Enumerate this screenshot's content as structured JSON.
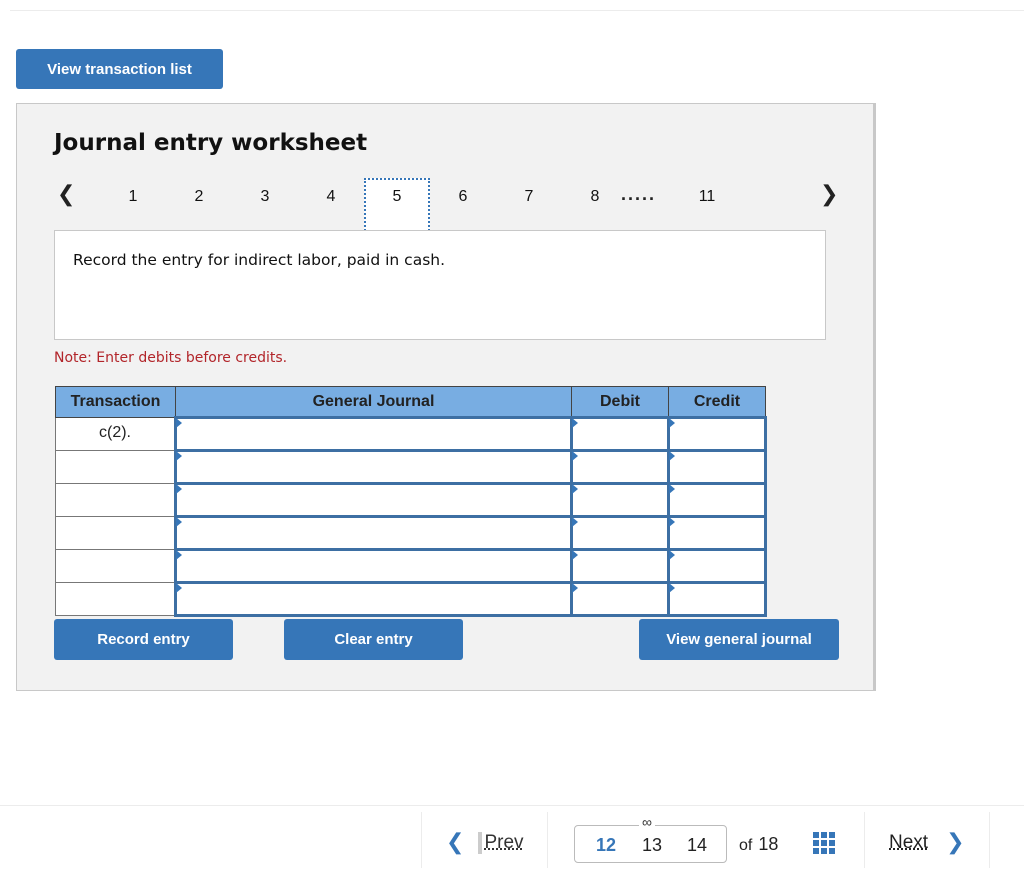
{
  "header": {
    "view_transactions_label": "View transaction list"
  },
  "worksheet": {
    "title": "Journal entry worksheet",
    "nav": {
      "prev_icon": "chevron-left-icon",
      "next_icon": "chevron-right-icon",
      "steps": [
        "1",
        "2",
        "3",
        "4",
        "5",
        "6",
        "7",
        "8"
      ],
      "ellipsis": ".....",
      "last_step": "11",
      "selected_step": "5"
    },
    "prompt": "Record the entry for indirect labor, paid in cash.",
    "note": "Note: Enter debits before credits."
  },
  "table": {
    "headers": [
      "Transaction",
      "General Journal",
      "Debit",
      "Credit"
    ],
    "rows": [
      {
        "transaction": "c(2).",
        "account": "",
        "debit": "",
        "credit": ""
      },
      {
        "transaction": "",
        "account": "",
        "debit": "",
        "credit": ""
      },
      {
        "transaction": "",
        "account": "",
        "debit": "",
        "credit": ""
      },
      {
        "transaction": "",
        "account": "",
        "debit": "",
        "credit": ""
      },
      {
        "transaction": "",
        "account": "",
        "debit": "",
        "credit": ""
      },
      {
        "transaction": "",
        "account": "",
        "debit": "",
        "credit": ""
      }
    ]
  },
  "actions": {
    "record": "Record entry",
    "clear": "Clear entry",
    "view_journal": "View general journal"
  },
  "footer": {
    "prev_label": "Prev",
    "next_label": "Next",
    "pages": [
      "12",
      "13",
      "14"
    ],
    "current_page": "12",
    "of_label": "of",
    "total_pages": "18",
    "link_icon": "link-icon",
    "grid_icon": "grid-icon",
    "accent_color": "#3676b8"
  }
}
